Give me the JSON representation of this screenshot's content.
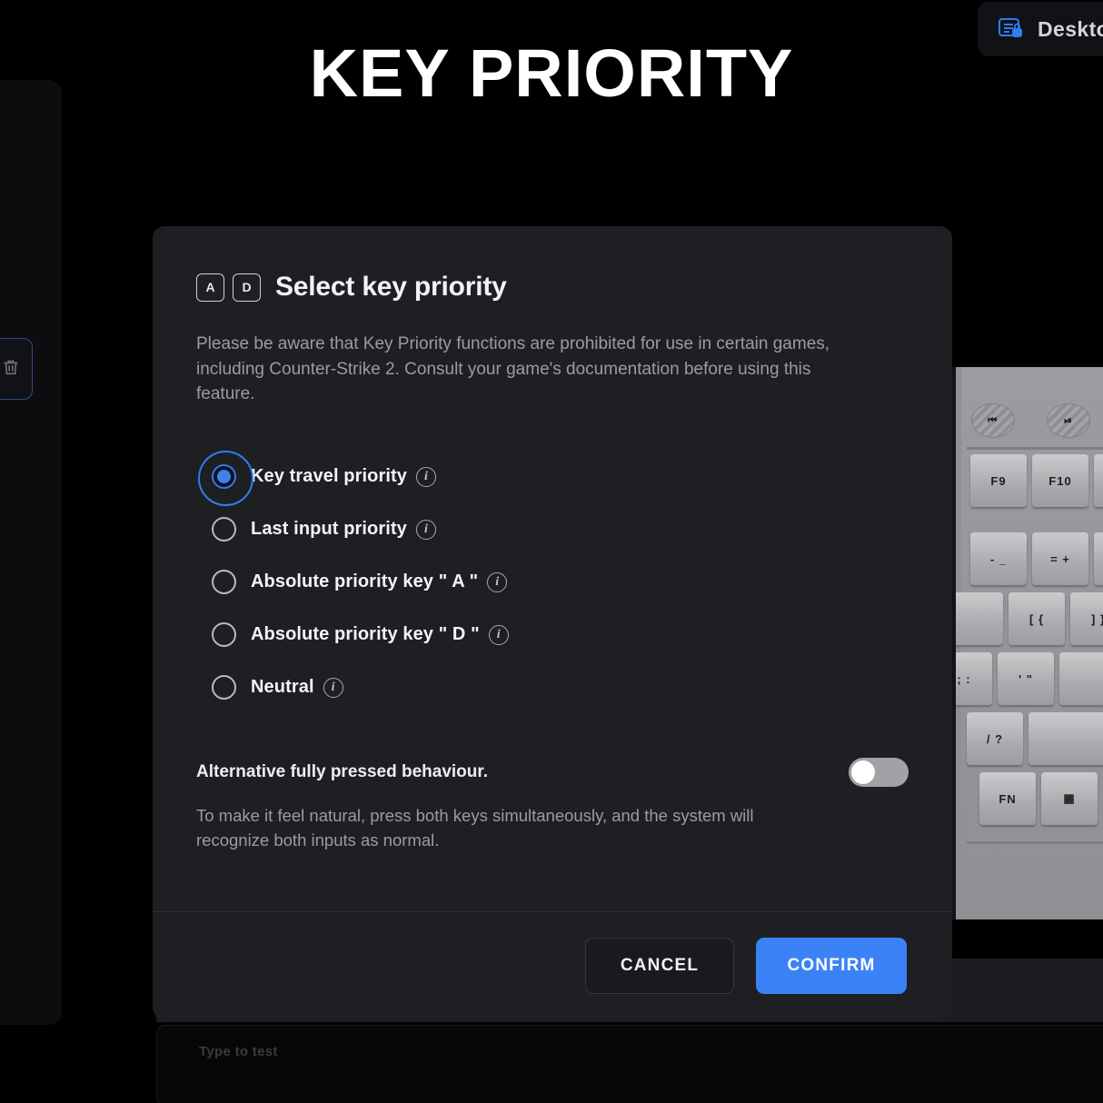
{
  "page": {
    "title": "KEY PRIORITY",
    "background_color": "#000000"
  },
  "topbar": {
    "desktop_pill": {
      "label": "Desktop",
      "icon": "document-lock-icon",
      "icon_color": "#2f7ef2"
    }
  },
  "sidebar": {
    "delete_button": {
      "icon": "trash-icon",
      "border_color": "#2d4a86"
    }
  },
  "background": {
    "test_input_placeholder": "Type to test",
    "keyboard_image": {
      "alt": "keyboard-photo",
      "visible_keys": [
        "prev-track",
        "play-pause",
        "F9",
        "F10",
        "- _",
        "= +",
        "[ {",
        "] }",
        "; :",
        "' \"",
        "/ ?",
        "FN",
        "menu"
      ]
    }
  },
  "modal": {
    "keycaps": [
      "A",
      "D"
    ],
    "title": "Select key priority",
    "description": "Please be aware that Key Priority functions are prohibited for use in certain games, including Counter-Strike 2. Consult your game's documentation before using this feature.",
    "options": [
      {
        "label": "Key travel priority",
        "selected": true,
        "info_icon": "info-icon"
      },
      {
        "label": "Last input priority",
        "selected": false,
        "info_icon": "info-icon"
      },
      {
        "label": "Absolute priority key \" A \"",
        "selected": false,
        "info_icon": "info-icon"
      },
      {
        "label": "Absolute priority key \" D \"",
        "selected": false,
        "info_icon": "info-icon"
      },
      {
        "label": "Neutral",
        "selected": false,
        "info_icon": "info-icon"
      }
    ],
    "alternative": {
      "title": "Alternative fully pressed behaviour.",
      "description": "To make it feel natural, press both keys simultaneously, and the system will recognize both inputs as normal.",
      "toggle_state": "off"
    },
    "footer": {
      "cancel_label": "CANCEL",
      "confirm_label": "CONFIRM",
      "confirm_color": "#3b82f6"
    }
  }
}
